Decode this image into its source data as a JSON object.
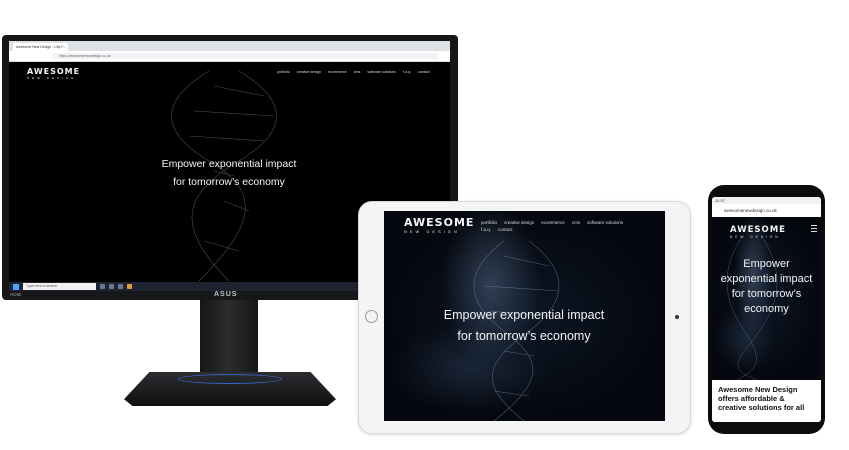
{
  "site": {
    "logo_main": "AWESOME",
    "logo_sub": "NEW DESIGN",
    "nav": [
      "portfolio",
      "creative design",
      "ecommerce",
      "cms",
      "software solutions",
      "f.a.q.",
      "contact"
    ],
    "headline_line1": "Empower exponential impact",
    "headline_line2": "for tomorrow’s economy"
  },
  "monitor": {
    "tab_title": "Awesome New Design - Lilly F...",
    "url": "https://awesomenewdesign.co.uk",
    "taskbar_search": "Type here to search",
    "brand": "ASUS",
    "port_label": "HDMI"
  },
  "phone": {
    "status_time": "11:37",
    "url": "awesomenewdesign.co.uk",
    "headline": "Empower exponential impact for tomorrow’s economy",
    "body_text": "Awesome New Design offers affordable & creative solutions for all"
  },
  "colors": {
    "accent": "#e8742c",
    "screen_bg": "#05080f"
  }
}
